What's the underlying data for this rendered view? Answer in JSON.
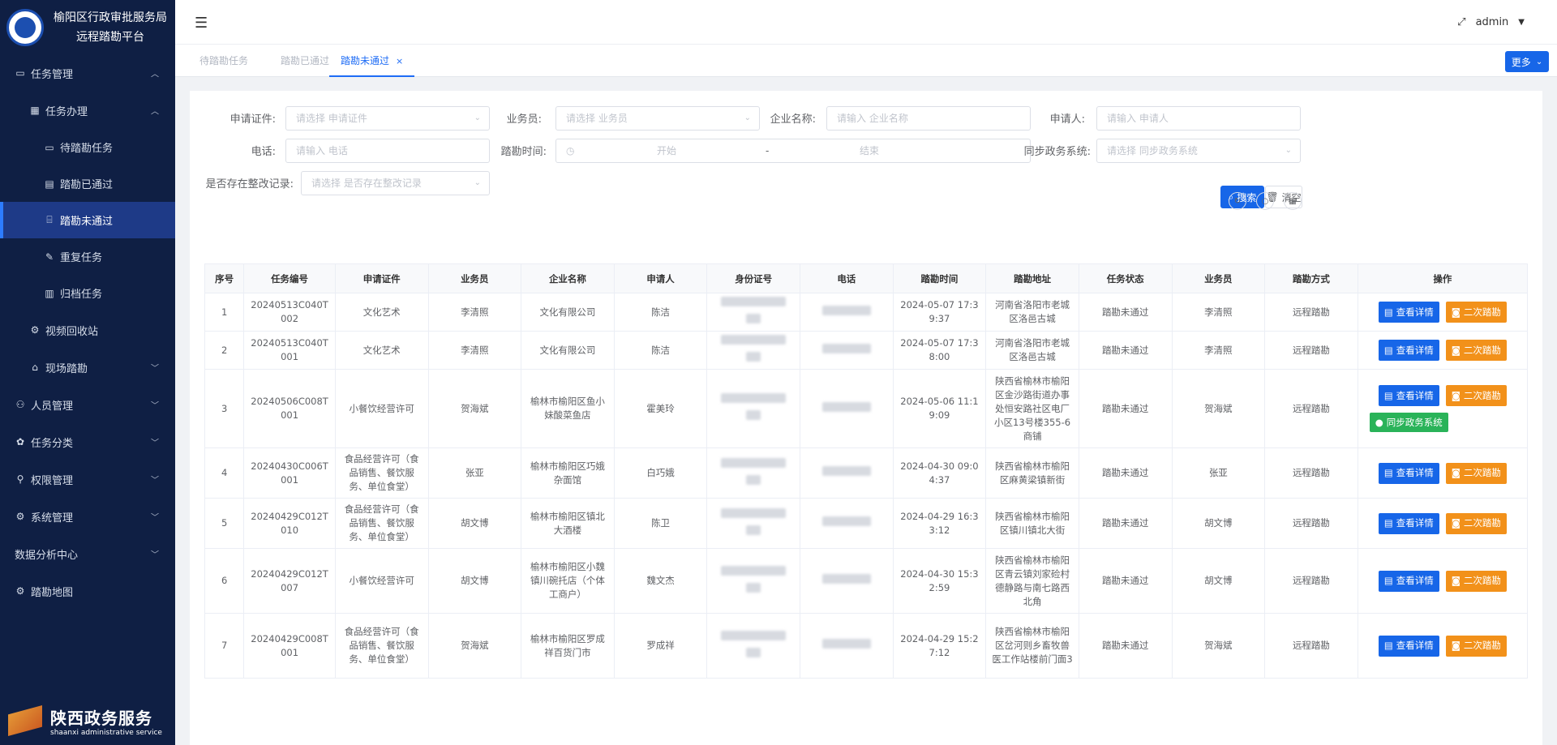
{
  "brand": {
    "line1": "榆阳区行政审批服务局",
    "line2": "远程踏勘平台"
  },
  "sidebar": {
    "items": [
      {
        "label": "任务管理",
        "icon": "monitor-icon",
        "level": 1,
        "arrow": "up"
      },
      {
        "label": "任务办理",
        "icon": "calendar-icon",
        "level": 2,
        "arrow": "up"
      },
      {
        "label": "待踏勘任务",
        "icon": "monitor-icon",
        "level": 3
      },
      {
        "label": "踏勘已通过",
        "icon": "document-icon",
        "level": 3
      },
      {
        "label": "踏勘未通过",
        "icon": "code-window-icon",
        "level": 3,
        "active": true
      },
      {
        "label": "重复任务",
        "icon": "pen-window-icon",
        "level": 3
      },
      {
        "label": "归档任务",
        "icon": "archive-icon",
        "level": 3
      },
      {
        "label": "视频回收站",
        "icon": "gear-icon",
        "level": 2
      },
      {
        "label": "现场踏勘",
        "icon": "home-icon",
        "level": 2,
        "arrow": "down"
      },
      {
        "label": "人员管理",
        "icon": "users-icon",
        "level": 1,
        "arrow": "down"
      },
      {
        "label": "任务分类",
        "icon": "palette-icon",
        "level": 1,
        "arrow": "down"
      },
      {
        "label": "权限管理",
        "icon": "user-lock-icon",
        "level": 1,
        "arrow": "down"
      },
      {
        "label": "系统管理",
        "icon": "gear-icon",
        "level": 1,
        "arrow": "down"
      },
      {
        "label": "数据分析中心",
        "icon": "",
        "level": 1,
        "arrow": "down"
      },
      {
        "label": "踏勘地图",
        "icon": "gear-icon",
        "level": 1
      }
    ],
    "footer": {
      "title": "陕西政务服务",
      "subtitle": "shaanxi administrative service"
    }
  },
  "header": {
    "user": "admin"
  },
  "tabs": [
    {
      "label": "待踏勘任务"
    },
    {
      "label": "踏勘已通过"
    },
    {
      "label": "踏勘未通过",
      "active": true,
      "close": "×"
    }
  ],
  "more_label": "更多",
  "filters": {
    "cert": {
      "label": "申请证件:",
      "placeholder": "请选择 申请证件"
    },
    "staff": {
      "label": "业务员:",
      "placeholder": "请选择 业务员"
    },
    "company": {
      "label": "企业名称:",
      "placeholder": "请输入 企业名称"
    },
    "applicant": {
      "label": "申请人:",
      "placeholder": "请输入 申请人"
    },
    "phone": {
      "label": "电话:",
      "placeholder": "请输入 电话"
    },
    "time": {
      "label": "踏勘时间:",
      "start": "开始",
      "sep": "-",
      "end": "结束"
    },
    "sync": {
      "label": "同步政务系统:",
      "placeholder": "请选择 同步政务系统"
    },
    "rectify": {
      "label": "是否存在整改记录:",
      "placeholder": "请选择 是否存在整改记录"
    }
  },
  "actions": {
    "search": "搜索",
    "clear": "清空"
  },
  "table": {
    "headers": [
      "序号",
      "任务编号",
      "申请证件",
      "业务员",
      "企业名称",
      "申请人",
      "身份证号",
      "电话",
      "踏勘时间",
      "踏勘地址",
      "任务状态",
      "业务员",
      "踏勘方式",
      "操作"
    ],
    "view_label": "查看详情",
    "again_label": "二次踏勘",
    "sync_label": "同步政务系统",
    "rows": [
      {
        "no": "1",
        "task": "20240513C040T002",
        "cert": "文化艺术",
        "staff": "李清照",
        "company": "文化有限公司",
        "applicant": "陈洁",
        "time": "2024-05-07 17:39:37",
        "addr": "河南省洛阳市老城区洛邑古城",
        "status": "踏勘未通过",
        "staff2": "李清照",
        "mode": "远程踏勘",
        "sync": false
      },
      {
        "no": "2",
        "task": "20240513C040T001",
        "cert": "文化艺术",
        "staff": "李清照",
        "company": "文化有限公司",
        "applicant": "陈洁",
        "time": "2024-05-07 17:38:00",
        "addr": "河南省洛阳市老城区洛邑古城",
        "status": "踏勘未通过",
        "staff2": "李清照",
        "mode": "远程踏勘",
        "sync": false
      },
      {
        "no": "3",
        "task": "20240506C008T001",
        "cert": "小餐饮经营许可",
        "staff": "贺海斌",
        "company": "榆林市榆阳区鱼小妹酸菜鱼店",
        "applicant": "霍美玲",
        "time": "2024-05-06 11:19:09",
        "addr": "陕西省榆林市榆阳区金沙路街道办事处恒安路社区电厂小区13号楼355-6商铺",
        "status": "踏勘未通过",
        "staff2": "贺海斌",
        "mode": "远程踏勘",
        "sync": true
      },
      {
        "no": "4",
        "task": "20240430C006T001",
        "cert": "食品经营许可（食品销售、餐饮服务、单位食堂）",
        "staff": "张亚",
        "company": "榆林市榆阳区巧娥杂面馆",
        "applicant": "白巧娥",
        "time": "2024-04-30 09:04:37",
        "addr": "陕西省榆林市榆阳区麻黄梁镇新街",
        "status": "踏勘未通过",
        "staff2": "张亚",
        "mode": "远程踏勘",
        "sync": false
      },
      {
        "no": "5",
        "task": "20240429C012T010",
        "cert": "食品经营许可（食品销售、餐饮服务、单位食堂）",
        "staff": "胡文博",
        "company": "榆林市榆阳区镇北大酒楼",
        "applicant": "陈卫",
        "time": "2024-04-29 16:33:12",
        "addr": "陕西省榆林市榆阳区镇川镇北大街",
        "status": "踏勘未通过",
        "staff2": "胡文博",
        "mode": "远程踏勘",
        "sync": false
      },
      {
        "no": "6",
        "task": "20240429C012T007",
        "cert": "小餐饮经营许可",
        "staff": "胡文博",
        "company": "榆林市榆阳区小魏镇川碗托店（个体工商户）",
        "applicant": "魏文杰",
        "time": "2024-04-30 15:32:59",
        "addr": "陕西省榆林市榆阳区青云镇刘家硷村德静路与南七路西北角",
        "status": "踏勘未通过",
        "staff2": "胡文博",
        "mode": "远程踏勘",
        "sync": false
      },
      {
        "no": "7",
        "task": "20240429C008T001",
        "cert": "食品经营许可（食品销售、餐饮服务、单位食堂）",
        "staff": "贺海斌",
        "company": "榆林市榆阳区罗成祥百货门市",
        "applicant": "罗成祥",
        "time": "2024-04-29 15:27:12",
        "addr": "陕西省榆林市榆阳区岔河则乡畜牧兽医工作站楼前门面3",
        "status": "踏勘未通过",
        "staff2": "贺海斌",
        "mode": "远程踏勘",
        "sync": false
      }
    ]
  }
}
